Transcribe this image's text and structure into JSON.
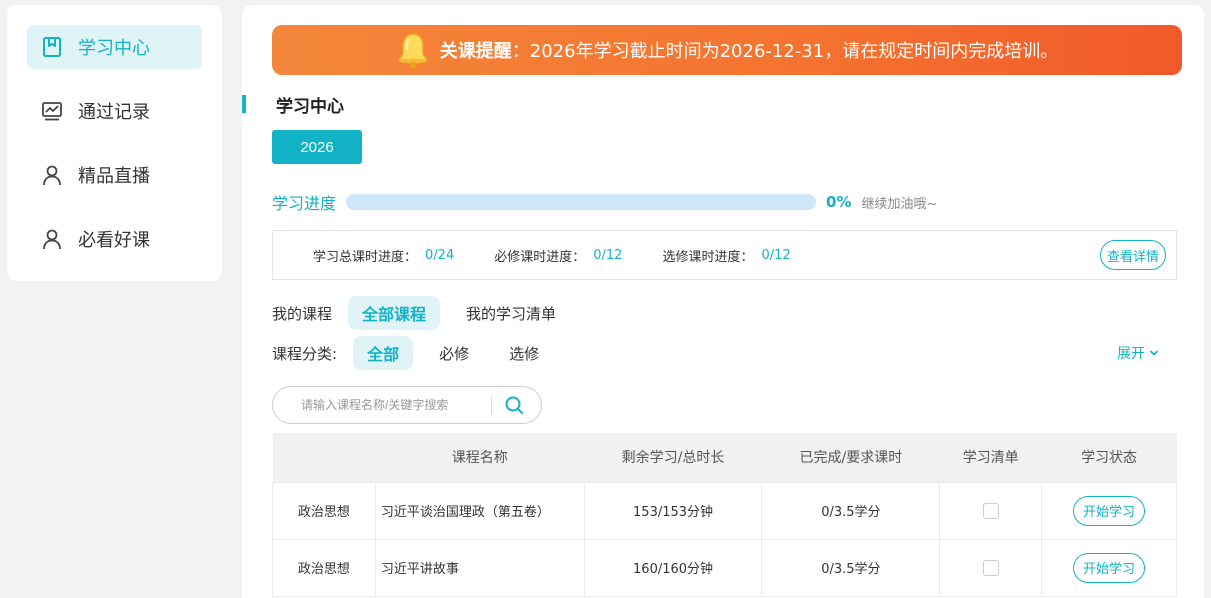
{
  "sidebar": {
    "items": [
      {
        "label": "学习中心",
        "icon": "bookmark-icon",
        "active": true
      },
      {
        "label": "通过记录",
        "icon": "chart-monitor-icon",
        "active": false
      },
      {
        "label": "精品直播",
        "icon": "user-icon",
        "active": false
      },
      {
        "label": "必看好课",
        "icon": "user-icon",
        "active": false
      }
    ]
  },
  "notice": {
    "title": "关课提醒",
    "text": "：2026年学习截止时间为2026-12-31，请在规定时间内完成培训。",
    "icon": "bell-icon"
  },
  "section": {
    "title": "学习中心"
  },
  "year": "2026",
  "progress": {
    "label": "学习进度",
    "value": 0,
    "percent_text": "0%",
    "cheer": "继续加油哦~"
  },
  "stats": {
    "total_label": "学习总课时进度：",
    "total_value": "0/24",
    "required_label": "必修课时进度：",
    "required_value": "0/12",
    "elective_label": "选修课时进度：",
    "elective_value": "0/12",
    "detail_button": "查看详情"
  },
  "my_courses": {
    "label": "我的课程",
    "tabs": [
      "全部课程",
      "我的学习清单"
    ]
  },
  "category": {
    "label": "课程分类:",
    "tabs": [
      "全部",
      "必修",
      "选修"
    ],
    "expand": "展开"
  },
  "search": {
    "placeholder": "请输入课程名称/关键字搜索",
    "icon": "search-icon"
  },
  "table": {
    "headers": [
      "",
      "课程名称",
      "剩余学习/总时长",
      "已完成/要求课时",
      "学习清单",
      "学习状态"
    ],
    "rows": [
      {
        "category": "政治思想",
        "name": "习近平谈治国理政（第五卷）",
        "duration": "153/153分钟",
        "credits": "0/3.5学分",
        "action": "开始学习"
      },
      {
        "category": "政治思想",
        "name": "习近平讲故事",
        "duration": "160/160分钟",
        "credits": "0/3.5学分",
        "action": "开始学习"
      }
    ]
  },
  "colors": {
    "accent": "#12b3c6",
    "notice_start": "#f3873a",
    "notice_end": "#f1592a",
    "progress_track": "#cde6fa"
  }
}
